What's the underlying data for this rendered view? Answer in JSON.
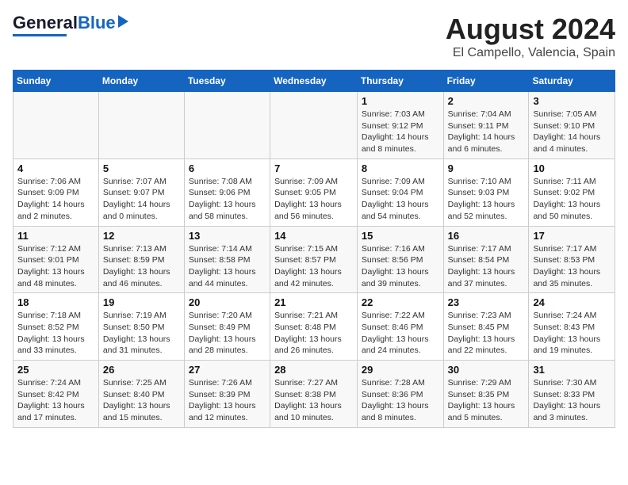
{
  "header": {
    "logo_general": "General",
    "logo_blue": "Blue",
    "month": "August 2024",
    "location": "El Campello, Valencia, Spain"
  },
  "days_of_week": [
    "Sunday",
    "Monday",
    "Tuesday",
    "Wednesday",
    "Thursday",
    "Friday",
    "Saturday"
  ],
  "weeks": [
    [
      {
        "day": "",
        "info": ""
      },
      {
        "day": "",
        "info": ""
      },
      {
        "day": "",
        "info": ""
      },
      {
        "day": "",
        "info": ""
      },
      {
        "day": "1",
        "info": "Sunrise: 7:03 AM\nSunset: 9:12 PM\nDaylight: 14 hours\nand 8 minutes."
      },
      {
        "day": "2",
        "info": "Sunrise: 7:04 AM\nSunset: 9:11 PM\nDaylight: 14 hours\nand 6 minutes."
      },
      {
        "day": "3",
        "info": "Sunrise: 7:05 AM\nSunset: 9:10 PM\nDaylight: 14 hours\nand 4 minutes."
      }
    ],
    [
      {
        "day": "4",
        "info": "Sunrise: 7:06 AM\nSunset: 9:09 PM\nDaylight: 14 hours\nand 2 minutes."
      },
      {
        "day": "5",
        "info": "Sunrise: 7:07 AM\nSunset: 9:07 PM\nDaylight: 14 hours\nand 0 minutes."
      },
      {
        "day": "6",
        "info": "Sunrise: 7:08 AM\nSunset: 9:06 PM\nDaylight: 13 hours\nand 58 minutes."
      },
      {
        "day": "7",
        "info": "Sunrise: 7:09 AM\nSunset: 9:05 PM\nDaylight: 13 hours\nand 56 minutes."
      },
      {
        "day": "8",
        "info": "Sunrise: 7:09 AM\nSunset: 9:04 PM\nDaylight: 13 hours\nand 54 minutes."
      },
      {
        "day": "9",
        "info": "Sunrise: 7:10 AM\nSunset: 9:03 PM\nDaylight: 13 hours\nand 52 minutes."
      },
      {
        "day": "10",
        "info": "Sunrise: 7:11 AM\nSunset: 9:02 PM\nDaylight: 13 hours\nand 50 minutes."
      }
    ],
    [
      {
        "day": "11",
        "info": "Sunrise: 7:12 AM\nSunset: 9:01 PM\nDaylight: 13 hours\nand 48 minutes."
      },
      {
        "day": "12",
        "info": "Sunrise: 7:13 AM\nSunset: 8:59 PM\nDaylight: 13 hours\nand 46 minutes."
      },
      {
        "day": "13",
        "info": "Sunrise: 7:14 AM\nSunset: 8:58 PM\nDaylight: 13 hours\nand 44 minutes."
      },
      {
        "day": "14",
        "info": "Sunrise: 7:15 AM\nSunset: 8:57 PM\nDaylight: 13 hours\nand 42 minutes."
      },
      {
        "day": "15",
        "info": "Sunrise: 7:16 AM\nSunset: 8:56 PM\nDaylight: 13 hours\nand 39 minutes."
      },
      {
        "day": "16",
        "info": "Sunrise: 7:17 AM\nSunset: 8:54 PM\nDaylight: 13 hours\nand 37 minutes."
      },
      {
        "day": "17",
        "info": "Sunrise: 7:17 AM\nSunset: 8:53 PM\nDaylight: 13 hours\nand 35 minutes."
      }
    ],
    [
      {
        "day": "18",
        "info": "Sunrise: 7:18 AM\nSunset: 8:52 PM\nDaylight: 13 hours\nand 33 minutes."
      },
      {
        "day": "19",
        "info": "Sunrise: 7:19 AM\nSunset: 8:50 PM\nDaylight: 13 hours\nand 31 minutes."
      },
      {
        "day": "20",
        "info": "Sunrise: 7:20 AM\nSunset: 8:49 PM\nDaylight: 13 hours\nand 28 minutes."
      },
      {
        "day": "21",
        "info": "Sunrise: 7:21 AM\nSunset: 8:48 PM\nDaylight: 13 hours\nand 26 minutes."
      },
      {
        "day": "22",
        "info": "Sunrise: 7:22 AM\nSunset: 8:46 PM\nDaylight: 13 hours\nand 24 minutes."
      },
      {
        "day": "23",
        "info": "Sunrise: 7:23 AM\nSunset: 8:45 PM\nDaylight: 13 hours\nand 22 minutes."
      },
      {
        "day": "24",
        "info": "Sunrise: 7:24 AM\nSunset: 8:43 PM\nDaylight: 13 hours\nand 19 minutes."
      }
    ],
    [
      {
        "day": "25",
        "info": "Sunrise: 7:24 AM\nSunset: 8:42 PM\nDaylight: 13 hours\nand 17 minutes."
      },
      {
        "day": "26",
        "info": "Sunrise: 7:25 AM\nSunset: 8:40 PM\nDaylight: 13 hours\nand 15 minutes."
      },
      {
        "day": "27",
        "info": "Sunrise: 7:26 AM\nSunset: 8:39 PM\nDaylight: 13 hours\nand 12 minutes."
      },
      {
        "day": "28",
        "info": "Sunrise: 7:27 AM\nSunset: 8:38 PM\nDaylight: 13 hours\nand 10 minutes."
      },
      {
        "day": "29",
        "info": "Sunrise: 7:28 AM\nSunset: 8:36 PM\nDaylight: 13 hours\nand 8 minutes."
      },
      {
        "day": "30",
        "info": "Sunrise: 7:29 AM\nSunset: 8:35 PM\nDaylight: 13 hours\nand 5 minutes."
      },
      {
        "day": "31",
        "info": "Sunrise: 7:30 AM\nSunset: 8:33 PM\nDaylight: 13 hours\nand 3 minutes."
      }
    ]
  ]
}
